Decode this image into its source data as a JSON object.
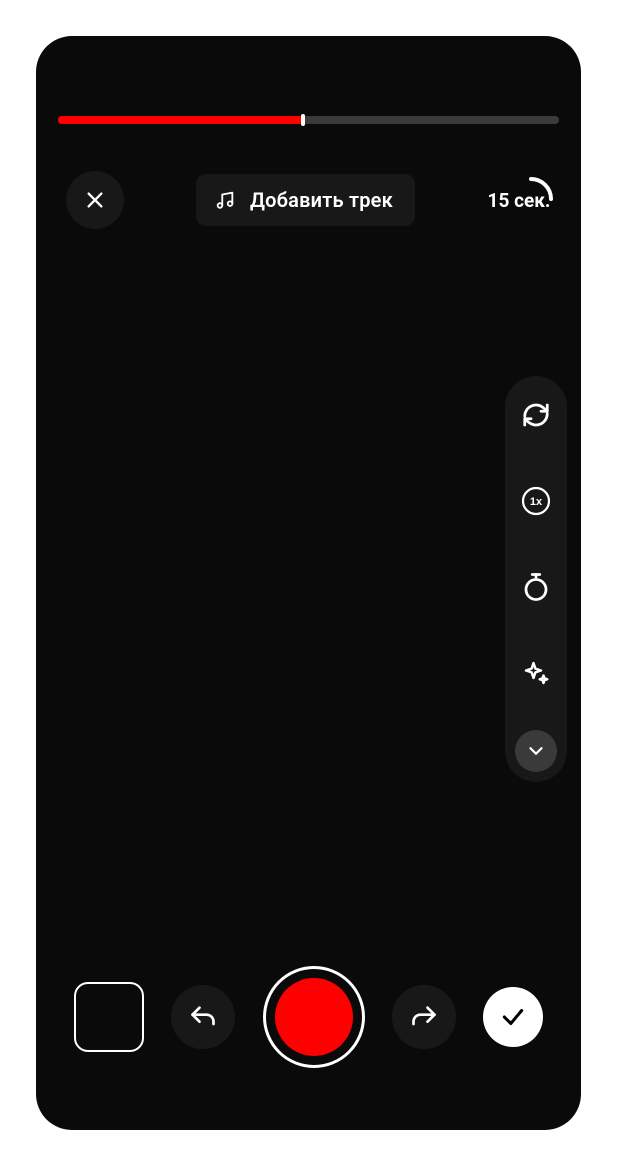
{
  "progress": {
    "percent": 49
  },
  "top": {
    "add_track_label": "Добавить трек",
    "duration_label": "15 сек."
  },
  "side": {
    "speed_label": "1x"
  },
  "icons": {
    "close": "close",
    "music": "music",
    "switch_camera": "switch-camera",
    "speed": "speed",
    "timer": "timer",
    "effects": "effects",
    "expand": "chevron-down",
    "undo": "undo",
    "redo": "redo",
    "check": "check"
  },
  "colors": {
    "accent": "#ff0000",
    "bg": "#0a0a0a",
    "panel": "#181818"
  }
}
